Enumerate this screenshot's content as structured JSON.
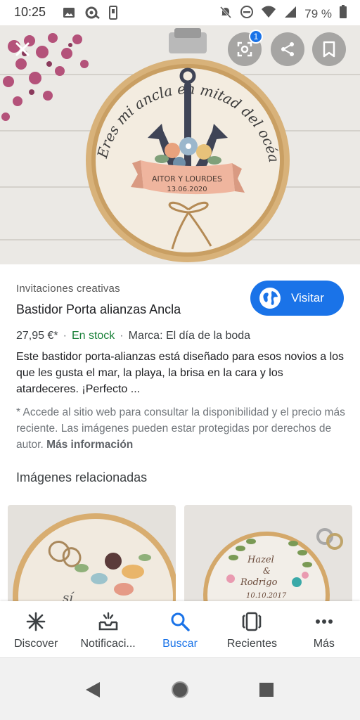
{
  "status_bar": {
    "time": "10:25",
    "battery_text": "79 %"
  },
  "hero": {
    "lens_badge": "1",
    "hoop_text": "Eres mi ancla en mitad del océano",
    "banner_name": "AITOR Y LOURDES",
    "banner_date": "13.06.2020"
  },
  "result": {
    "source": "Invitaciones creativas",
    "title": "Bastidor Porta alianzas Ancla",
    "visit_label": "Visitar",
    "price": "27,95 €*",
    "stock": "En stock",
    "brand": "Marca: El día de la boda",
    "description": "Este bastidor porta-alianzas está diseñado para esos novios a los que les gusta el mar, la playa, la brisa en la cara y los atardeceres. ¡Perfecto ...",
    "note": "* Accede al sitio web para consultar la disponibilidad y el precio más reciente. Las imágenes pueden estar protegidas por derechos de autor.",
    "more_info": "Más información"
  },
  "related": {
    "title": "Imágenes relacionadas",
    "thumb1_text": "sí",
    "thumb2_line1": "Hazel",
    "thumb2_line2": "&",
    "thumb2_line3": "Rodrigo",
    "thumb2_line4": "10.10.2017"
  },
  "bottom_nav": {
    "items": [
      {
        "label": "Discover",
        "icon": "asterisk-icon"
      },
      {
        "label": "Notificaci...",
        "icon": "bell-tray-icon"
      },
      {
        "label": "Buscar",
        "icon": "search-icon"
      },
      {
        "label": "Recientes",
        "icon": "stacked-cards-icon"
      },
      {
        "label": "Más",
        "icon": "more-dots-icon"
      }
    ],
    "active": "Buscar"
  },
  "colors": {
    "accent": "#1a73e8",
    "in_stock": "#188038"
  }
}
